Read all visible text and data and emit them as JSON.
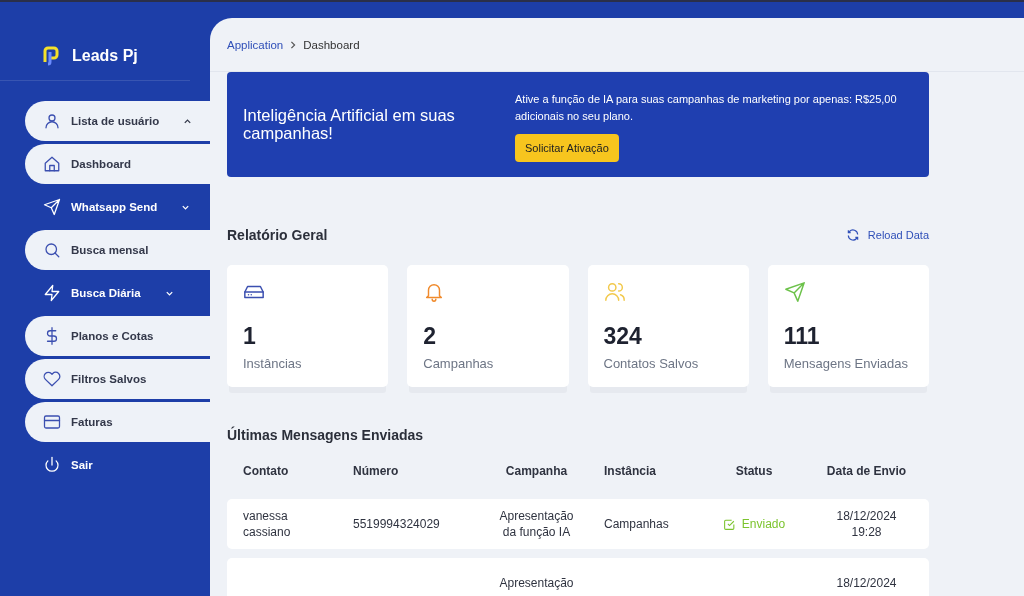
{
  "brand": {
    "name": "Leads Pj"
  },
  "sidebar": {
    "items": [
      {
        "label": "Lista de usuário",
        "highlighted": true,
        "expanded": true
      },
      {
        "label": "Dashboard",
        "highlighted": true
      },
      {
        "label": "Whatsapp Send",
        "highlighted": false,
        "expanded": false
      },
      {
        "label": "Busca mensal",
        "highlighted": true
      },
      {
        "label": "Busca Diária",
        "highlighted": false,
        "expanded": false
      },
      {
        "label": "Planos e Cotas",
        "highlighted": true
      },
      {
        "label": "Filtros Salvos",
        "highlighted": true
      },
      {
        "label": "Faturas",
        "highlighted": true
      },
      {
        "label": "Sair",
        "highlighted": false
      }
    ]
  },
  "breadcrumb": [
    "Application",
    "Dashboard"
  ],
  "banner": {
    "title": "Inteligência Artificial em suas campanhas!",
    "text": "Ative a função de IA para suas campanhas de marketing por apenas: R$25,00 adicionais no seu plano.",
    "button": "Solicitar Ativação"
  },
  "report": {
    "title": "Relatório Geral",
    "reload": "Reload Data",
    "stats": [
      {
        "value": "1",
        "label": "Instâncias",
        "color": "#3b4fb0"
      },
      {
        "value": "2",
        "label": "Campanhas",
        "color": "#f08a2c"
      },
      {
        "value": "324",
        "label": "Contatos Salvos",
        "color": "#f2c94c"
      },
      {
        "value": "111",
        "label": "Mensagens Enviadas",
        "color": "#6cc24a"
      }
    ]
  },
  "messages": {
    "title": "Últimas Mensagens Enviadas",
    "columns": [
      "Contato",
      "Número",
      "Campanha",
      "Instância",
      "Status",
      "Data de Envio"
    ],
    "rows": [
      {
        "contato": "vanessa cassiano",
        "numero": "5519994324029",
        "campanha": "Apresentação da função IA",
        "instancia": "Campanhas",
        "status": "Enviado",
        "data": "18/12/2024 19:28"
      },
      {
        "campanha": "Apresentação",
        "data": "18/12/2024"
      }
    ]
  }
}
